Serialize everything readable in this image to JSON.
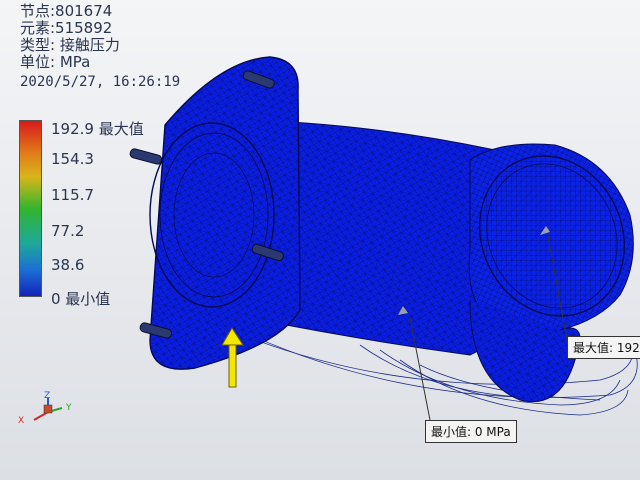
{
  "info": {
    "nodes": "节点:801674",
    "elements": "元素:515892",
    "type": "类型: 接触压力",
    "unit": "单位: MPa",
    "timestamp": "2020/5/27, 16:26:19"
  },
  "legend": {
    "labels": [
      "192.9 最大值",
      "154.3",
      "115.7",
      "77.2",
      "38.6",
      "0 最小值"
    ]
  },
  "callouts": {
    "max": "最大值: 192",
    "min": "最小值: 0 MPa"
  },
  "triad": {
    "x": "X",
    "y": "Y",
    "z": "Z"
  },
  "colors": {
    "mesh_blue": "#0a1ee6",
    "mesh_line": "#050a55",
    "arrow_yellow": "#f3e600"
  }
}
